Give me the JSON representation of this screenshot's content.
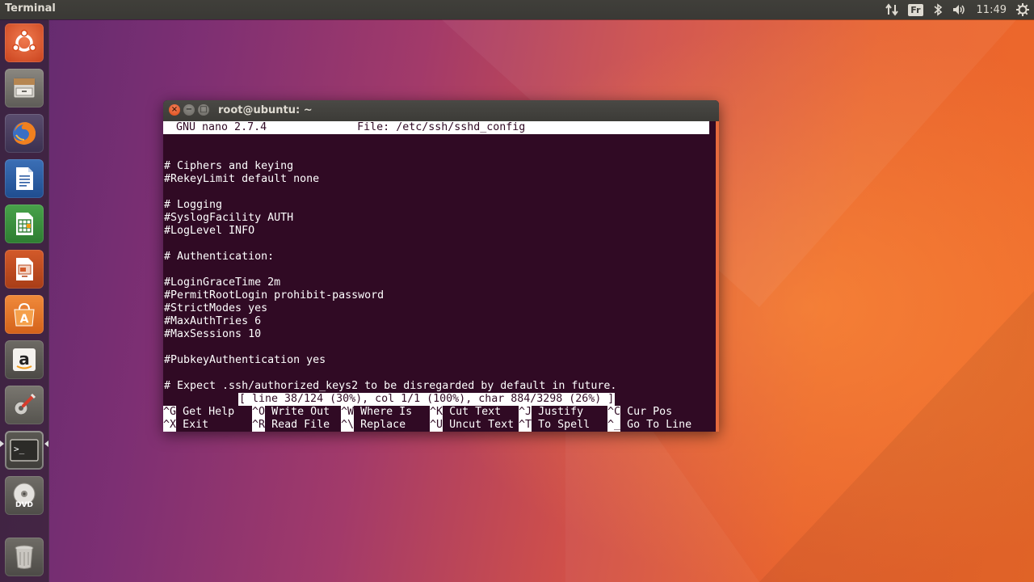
{
  "top_panel": {
    "app_title": "Terminal",
    "keyboard_layout": "Fr",
    "clock": "11:49"
  },
  "launcher": {
    "items": [
      {
        "name": "dash-home",
        "icon": "ubuntu-logo-icon"
      },
      {
        "name": "files",
        "icon": "file-cabinet-icon"
      },
      {
        "name": "firefox",
        "icon": "firefox-icon"
      },
      {
        "name": "libreoffice-writer",
        "icon": "writer-document-icon"
      },
      {
        "name": "libreoffice-calc",
        "icon": "calc-spreadsheet-icon"
      },
      {
        "name": "libreoffice-impress",
        "icon": "impress-presentation-icon"
      },
      {
        "name": "ubuntu-software",
        "icon": "software-bag-icon"
      },
      {
        "name": "amazon",
        "icon": "amazon-icon"
      },
      {
        "name": "system-settings",
        "icon": "settings-wrench-icon"
      },
      {
        "name": "terminal",
        "icon": "terminal-prompt-icon",
        "active": true
      },
      {
        "name": "dvd",
        "icon": "dvd-disc-icon"
      },
      {
        "name": "trash",
        "icon": "trash-icon"
      }
    ],
    "amazon_glyph": "a",
    "software_glyph": "A",
    "dvd_label": "DVD",
    "terminal_glyph": ">_"
  },
  "window": {
    "title": "root@ubuntu: ~",
    "close_glyph": "×",
    "min_glyph": "−",
    "max_glyph": "□"
  },
  "nano": {
    "header": "  GNU nano 2.7.4              File: /etc/ssh/sshd_config",
    "lines": [
      "",
      "",
      "# Ciphers and keying",
      "#RekeyLimit default none",
      "",
      "# Logging",
      "#SyslogFacility AUTH",
      "#LogLevel INFO",
      "",
      "# Authentication:",
      "",
      "#LoginGraceTime 2m",
      "#PermitRootLogin prohibit-password",
      "#StrictModes yes",
      "#MaxAuthTries 6",
      "#MaxSessions 10",
      "",
      "#PubkeyAuthentication yes",
      "",
      "# Expect .ssh/authorized_keys2 to be disregarded by default in future."
    ],
    "status": "[ line 38/124 (30%), col 1/1 (100%), char 884/3298 (26%) ]",
    "shortcuts_row1": [
      {
        "key": "^G",
        "label": " Get Help"
      },
      {
        "key": "^O",
        "label": " Write Out"
      },
      {
        "key": "^W",
        "label": " Where Is"
      },
      {
        "key": "^K",
        "label": " Cut Text"
      },
      {
        "key": "^J",
        "label": " Justify"
      },
      {
        "key": "^C",
        "label": " Cur Pos"
      }
    ],
    "shortcuts_row2": [
      {
        "key": "^X",
        "label": " Exit"
      },
      {
        "key": "^R",
        "label": " Read File"
      },
      {
        "key": "^\\",
        "label": " Replace"
      },
      {
        "key": "^U",
        "label": " Uncut Text"
      },
      {
        "key": "^T",
        "label": " To Spell"
      },
      {
        "key": "^_",
        "label": " Go To Line"
      }
    ]
  }
}
